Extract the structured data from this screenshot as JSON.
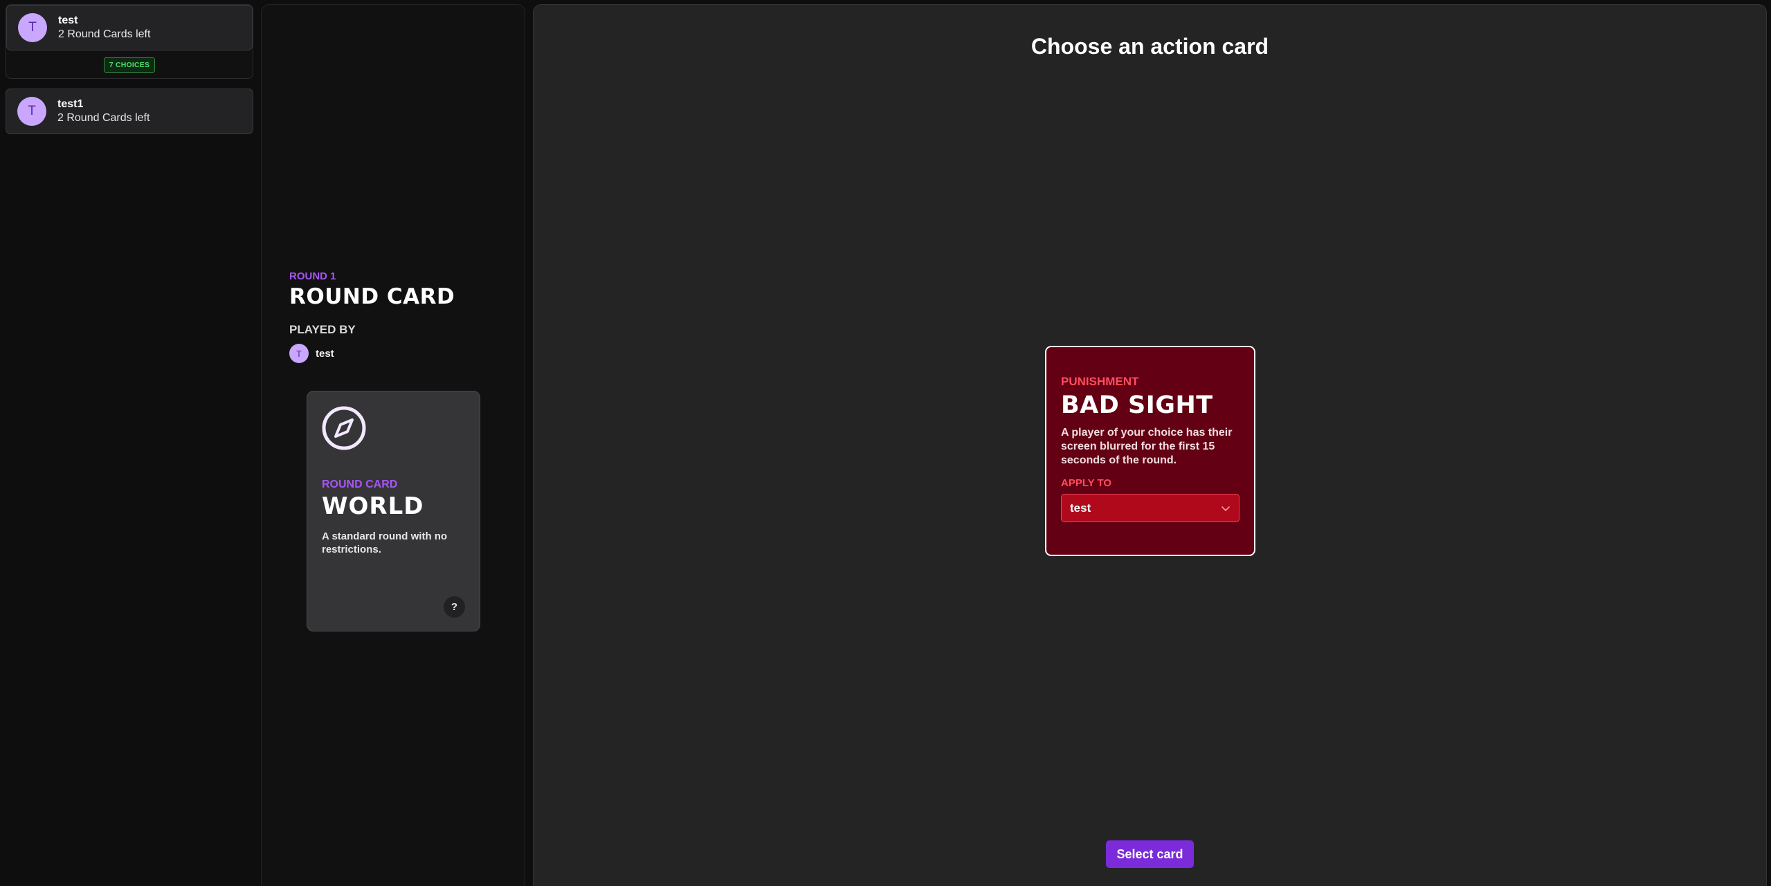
{
  "players": [
    {
      "initial": "T",
      "name": "test",
      "subtitle": "2 Round Cards left",
      "badge": "7 CHOICES"
    },
    {
      "initial": "T",
      "name": "test1",
      "subtitle": "2 Round Cards left"
    }
  ],
  "round": {
    "label": "ROUND 1",
    "title": "ROUND CARD",
    "played_by_label": "PLAYED BY",
    "played_by": {
      "initial": "T",
      "name": "test"
    },
    "card": {
      "icon": "compass-icon",
      "type": "ROUND CARD",
      "name": "WORLD",
      "description": "A standard round with no restrictions.",
      "help": "?"
    }
  },
  "main": {
    "title": "Choose an action card",
    "action_card": {
      "type": "PUNISHMENT",
      "name": "BAD SIGHT",
      "description": "A player of your choice has their screen blurred for the first 15 seconds of the round.",
      "apply_label": "APPLY TO",
      "apply_value": "test"
    },
    "select_label": "Select card"
  },
  "colors": {
    "accent": "#a855f7",
    "button": "#7b2bd9",
    "punishment": "#ff4d5e",
    "card_bg": "#630013",
    "badge": "#47e06a"
  }
}
